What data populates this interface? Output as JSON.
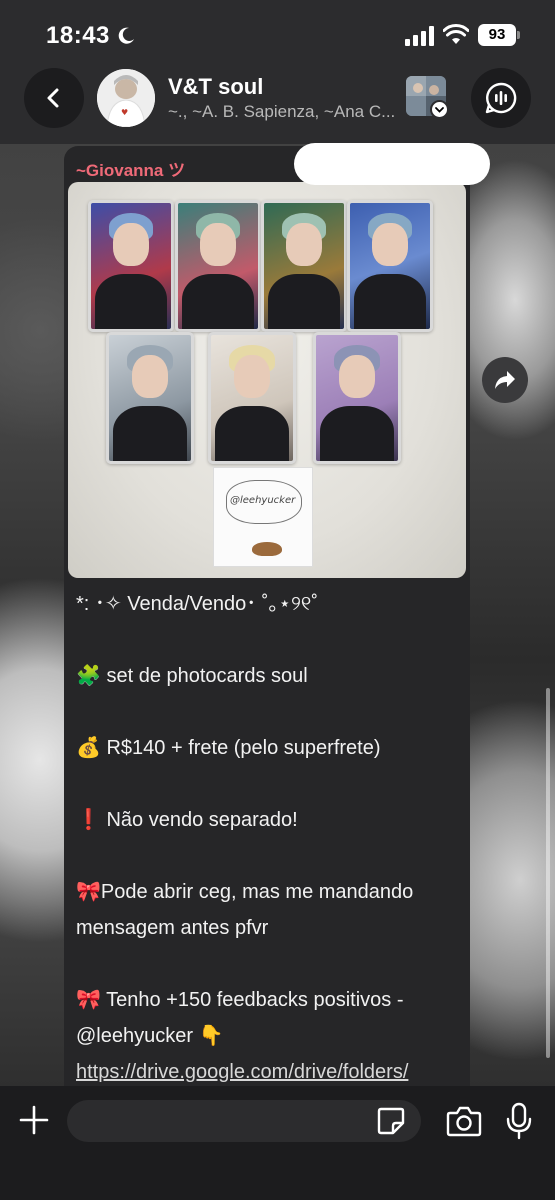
{
  "status_bar": {
    "time": "18:43",
    "battery": "93"
  },
  "header": {
    "title": "V&T soul",
    "members": "~., ~A. B. Sapienza, ~Ana C..."
  },
  "message": {
    "sender": "~Giovanna ツ",
    "note_handle": "@leehyucker",
    "lines": [
      "*: ･✧ Venda/Vendo･ ˚｡⋆୨୧˚",
      "",
      "🧩 set de photocards soul",
      "",
      "💰 R$140 + frete (pelo superfrete)",
      "",
      "❗ Não vendo separado!",
      "",
      "🎀Pode abrir ceg, mas me mandando",
      "mensagem antes pfvr",
      "",
      "🎀 Tenho +150 feedbacks positivos -",
      "@leehyucker 👇"
    ],
    "link": "https://drive.google.com/drive/folders/"
  },
  "input": {
    "placeholder": ""
  },
  "colors": {
    "sender_name": "#ef6a78",
    "bubble": "#262628",
    "header": "#2c2c2e"
  },
  "icons": [
    "moon-icon",
    "signal-icon",
    "wifi-icon",
    "back-chevron-icon",
    "chevron-down-icon",
    "call-icon",
    "forward-icon",
    "plus-icon",
    "sticker-icon",
    "camera-icon",
    "mic-icon"
  ]
}
